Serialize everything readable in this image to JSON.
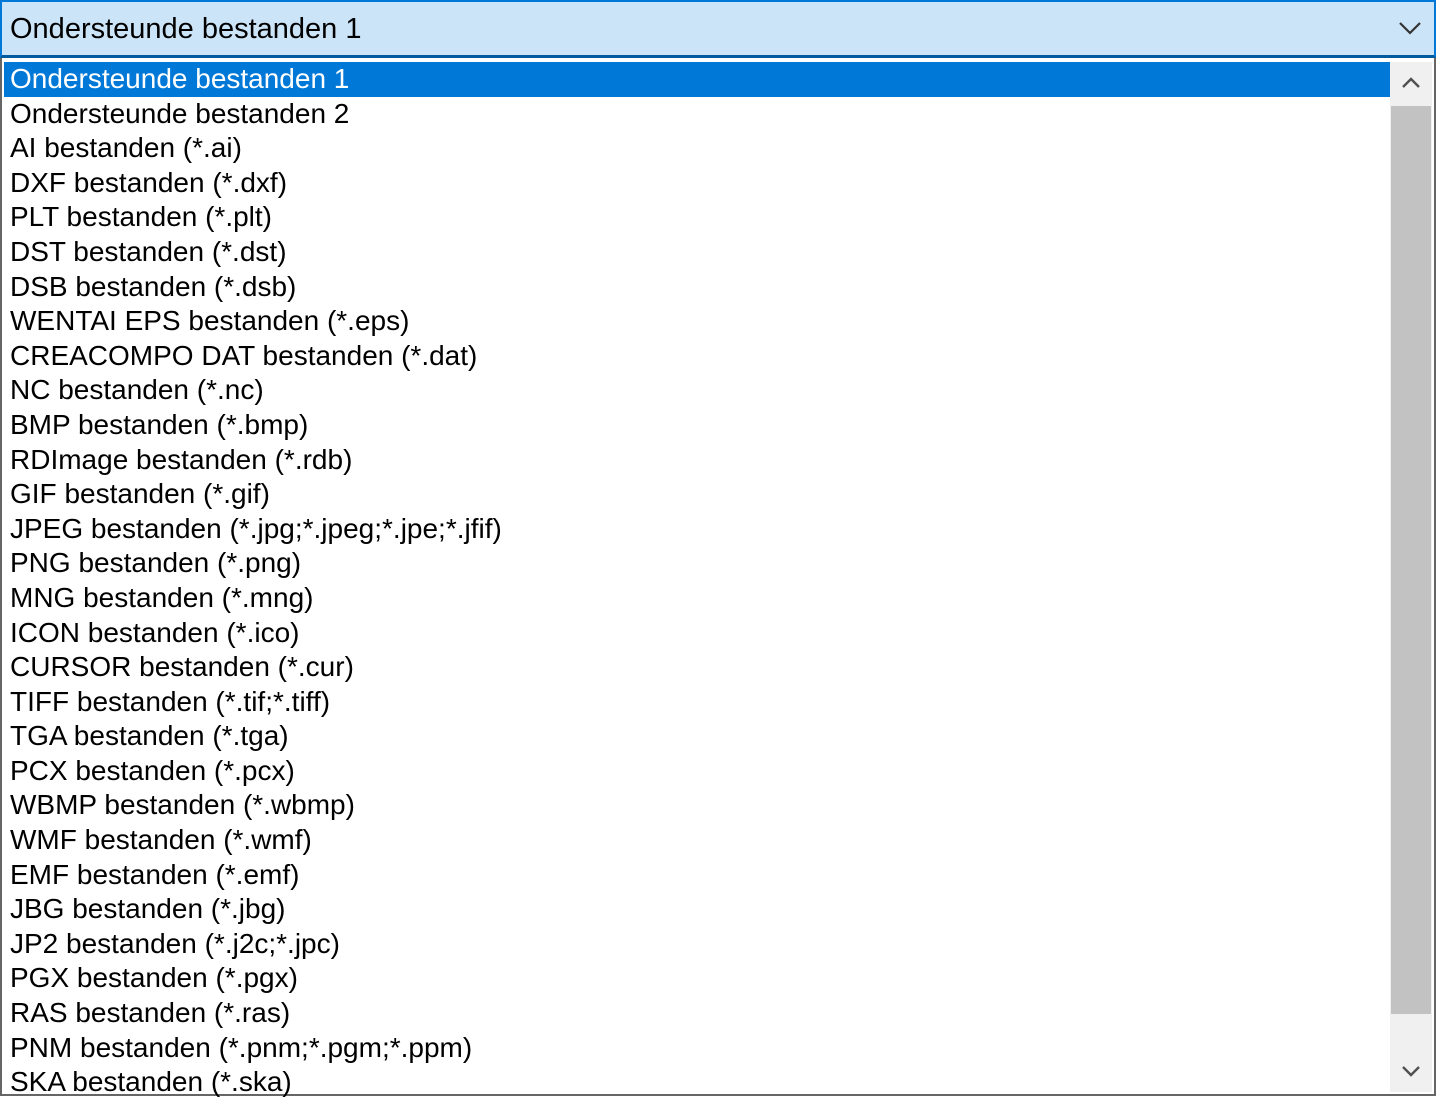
{
  "combo": {
    "selected_value": "Ondersteunde bestanden 1",
    "arrow_icon": "chevron-down-icon"
  },
  "options": [
    "Ondersteunde bestanden 1",
    "Ondersteunde bestanden 2",
    "AI bestanden (*.ai)",
    "DXF bestanden (*.dxf)",
    "PLT bestanden (*.plt)",
    "DST bestanden (*.dst)",
    "DSB bestanden (*.dsb)",
    "WENTAI EPS bestanden (*.eps)",
    "CREACOMPO DAT bestanden (*.dat)",
    "NC bestanden (*.nc)",
    "BMP bestanden (*.bmp)",
    "RDImage bestanden (*.rdb)",
    "GIF bestanden (*.gif)",
    "JPEG bestanden (*.jpg;*.jpeg;*.jpe;*.jfif)",
    "PNG bestanden (*.png)",
    "MNG bestanden (*.mng)",
    "ICON bestanden (*.ico)",
    "CURSOR bestanden (*.cur)",
    "TIFF bestanden (*.tif;*.tiff)",
    "TGA bestanden (*.tga)",
    "PCX bestanden (*.pcx)",
    "WBMP bestanden (*.wbmp)",
    "WMF bestanden (*.wmf)",
    "EMF bestanden (*.emf)",
    "JBG bestanden (*.jbg)",
    "JP2 bestanden (*.j2c;*.jpc)",
    "PGX bestanden (*.pgx)",
    "RAS bestanden (*.ras)",
    "PNM bestanden (*.pnm;*.pgm;*.ppm)",
    "SKA bestanden (*.ska)"
  ],
  "selected_index": 0,
  "scrollbar": {
    "up_icon": "chevron-up-icon",
    "down_icon": "chevron-down-icon"
  },
  "colors": {
    "header_bg": "#cce4f7",
    "focus_border": "#0078d7",
    "selection_bg": "#0078d7",
    "selection_text": "#ffffff",
    "scroll_track": "#f0f0f0",
    "scroll_thumb": "#c2c2c2"
  }
}
